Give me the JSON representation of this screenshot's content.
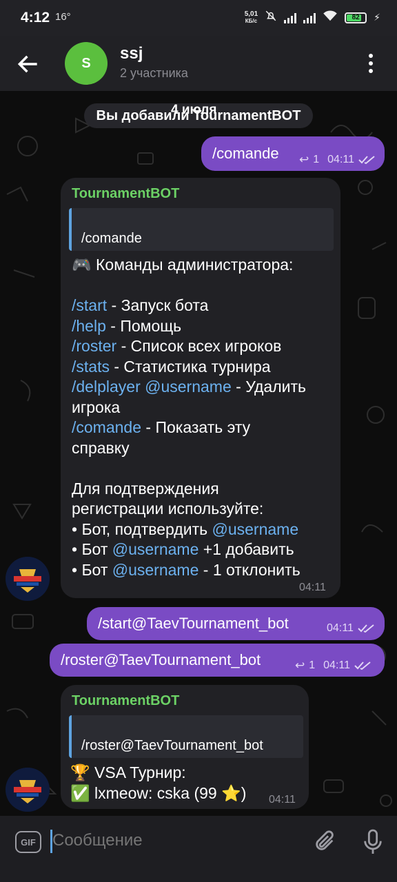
{
  "status_bar": {
    "time": "4:12",
    "temp": "16°",
    "speed_value": "5,01",
    "speed_unit": "КБ/с",
    "battery": "82",
    "battery_level": 0.82
  },
  "header": {
    "avatar_letter": "S",
    "title": "ssj",
    "subtitle": "2 участника"
  },
  "chat": {
    "service_message": "Вы добавили TournamentBOT",
    "date_pill": "4 июля",
    "messages": [
      {
        "text": "/comande",
        "reply_count": "1",
        "time": "04:11"
      },
      {
        "sender": "TournamentBOT",
        "quote": "/comande",
        "time": "04:11",
        "body": {
          "header": "🎮 Команды администратора:",
          "c1": "/start",
          "d1": " - Запуск бота",
          "c2": "/help",
          "d2": " - Помощь",
          "c3": "/roster",
          "d3": " - Список всех игроков",
          "c4": "/stats",
          "d4": " - Статистика турнира",
          "c5": "/delplayer @username",
          "d5": " - Удалить",
          "d5b": "игрока",
          "c6": "/comande",
          "d6": " - Показать эту",
          "d6b": "справку",
          "p1": "Для подтверждения",
          "p2": "регистрации используйте:",
          "b1a": "• Бот, подтвердить ",
          "b1u": "@username",
          "b2a": "• Бот ",
          "b2u": "@username",
          "b2b": " +1 добавить",
          "b3a": "• Бот ",
          "b3u": "@username",
          "b3b": " - 1 отклонить"
        }
      },
      {
        "text": "/start@TaevTournament_bot",
        "time": "04:11"
      },
      {
        "text": "/roster@TaevTournament_bot",
        "reply_count": "1",
        "time": "04:11"
      },
      {
        "sender": "TournamentBOT",
        "quote": "/roster@TaevTournament_bot",
        "time": "04:11",
        "line1": "🏆 VSA Турнир:",
        "line2": "✅ lxmeow: cska (99 ⭐)"
      }
    ]
  },
  "input": {
    "placeholder": "Сообщение",
    "gif_label": "GIF"
  },
  "colors": {
    "outgoing_bubble": "#7a4bc4",
    "incoming_bubble": "#212125",
    "sender_name": "#6cd165",
    "command_link": "#6cb1ef"
  }
}
